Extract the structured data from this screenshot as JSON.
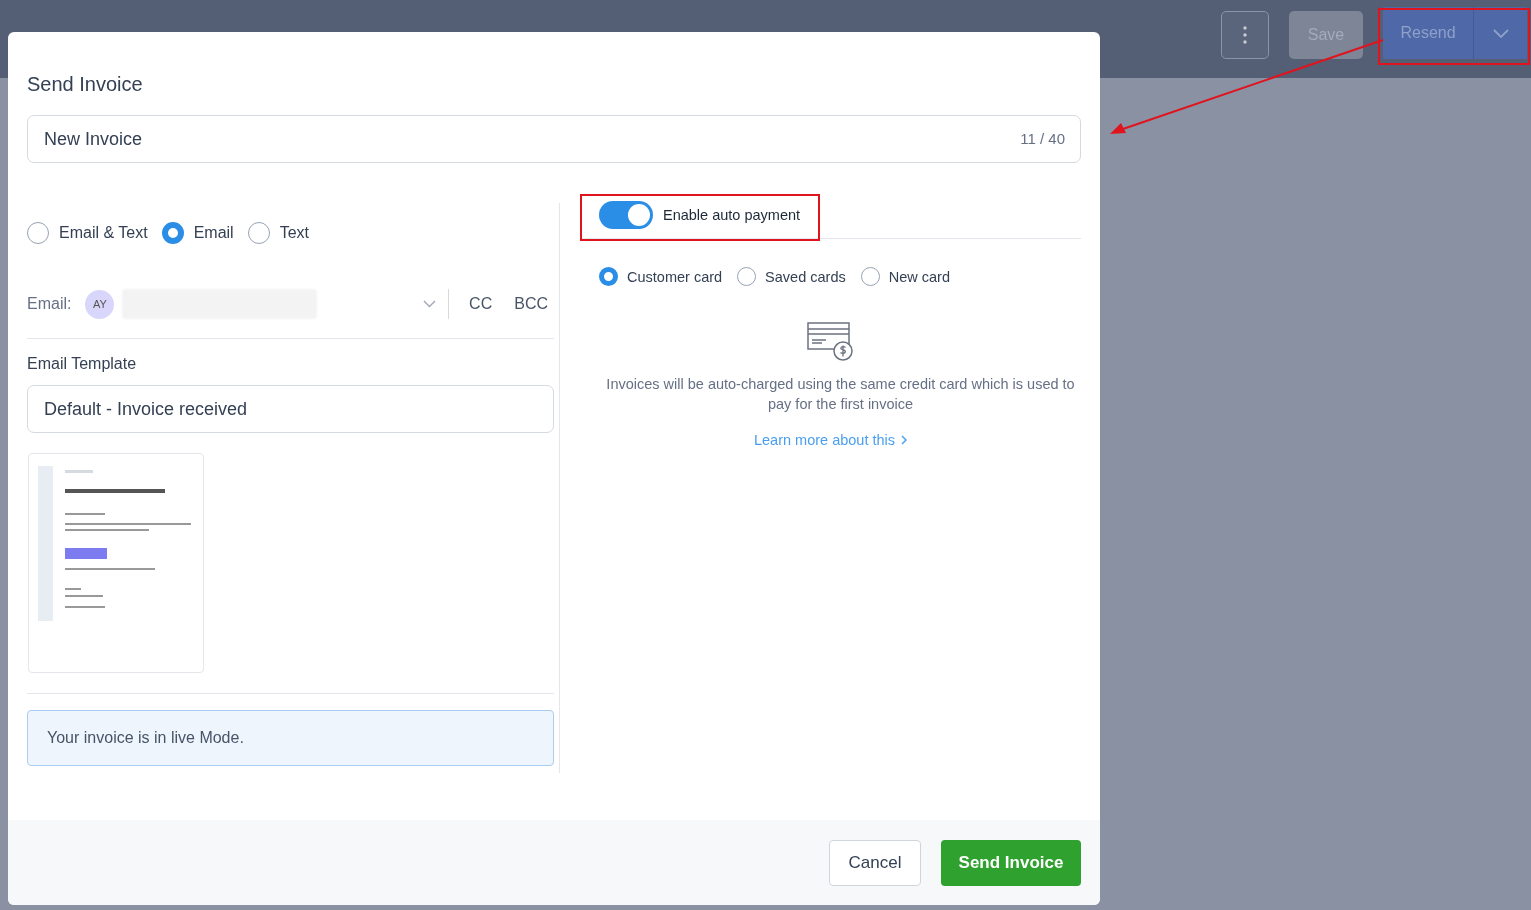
{
  "topbar": {
    "save": "Save",
    "resend": "Resend"
  },
  "dialog": {
    "title": "Send Invoice",
    "name_field": {
      "value": "New Invoice",
      "counter": "11 / 40"
    },
    "channels": [
      {
        "label": "Email & Text",
        "selected": false
      },
      {
        "label": "Email",
        "selected": true
      },
      {
        "label": "Text",
        "selected": false
      }
    ],
    "email": {
      "label": "Email:",
      "avatar": "AY",
      "cc": "CC",
      "bcc": "BCC"
    },
    "template": {
      "label": "Email Template",
      "value": "Default - Invoice received"
    },
    "notice": "Your invoice is in live Mode.",
    "auto_payment": {
      "label": "Enable auto payment",
      "on": true
    },
    "card_options": [
      {
        "label": "Customer card",
        "selected": true
      },
      {
        "label": "Saved cards",
        "selected": false
      },
      {
        "label": "New card",
        "selected": false
      }
    ],
    "description": "Invoices will be auto-charged using the same credit card which is used to pay for the first invoice",
    "link": "Learn more about this",
    "buttons": {
      "cancel": "Cancel",
      "send": "Send Invoice"
    }
  }
}
